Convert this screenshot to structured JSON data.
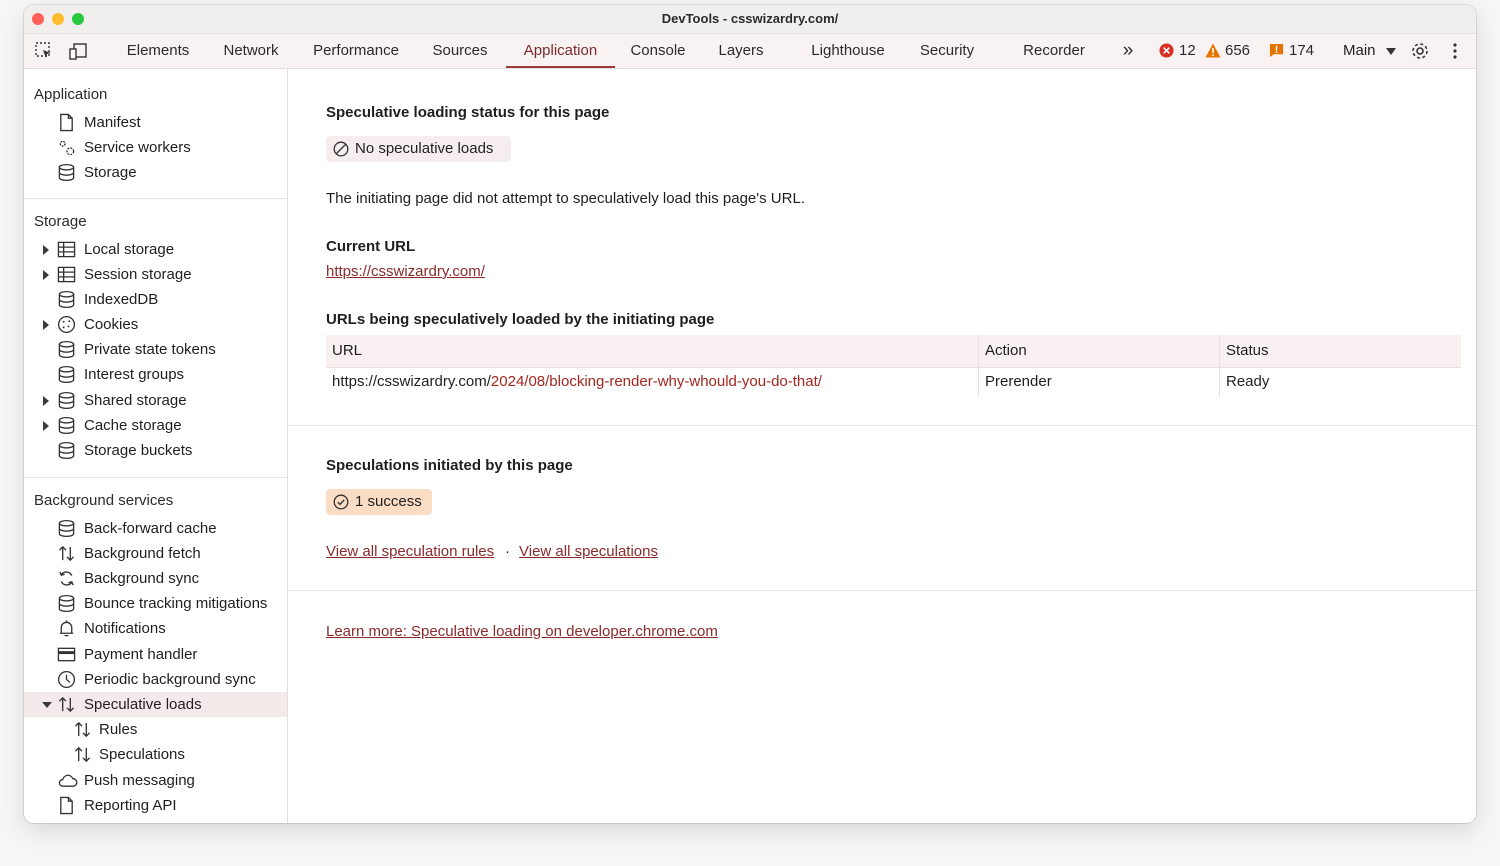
{
  "window": {
    "title": "DevTools - csswizardry.com/"
  },
  "toolbar": {
    "tabs": [
      {
        "label": "Elements"
      },
      {
        "label": "Network"
      },
      {
        "label": "Performance"
      },
      {
        "label": "Sources"
      },
      {
        "label": "Application"
      },
      {
        "label": "Console"
      },
      {
        "label": "Layers"
      },
      {
        "label": "Lighthouse"
      },
      {
        "label": "Security"
      },
      {
        "label": "Recorder"
      }
    ],
    "active_tab": "Application",
    "more_tabs": "»",
    "errors": "12",
    "warnings": "656",
    "issues": "174",
    "context": "Main"
  },
  "sidebar": {
    "application": {
      "title": "Application",
      "items": [
        {
          "label": "Manifest",
          "icon": "document-icon"
        },
        {
          "label": "Service workers",
          "icon": "gears-icon"
        },
        {
          "label": "Storage",
          "icon": "database-icon"
        }
      ]
    },
    "storage": {
      "title": "Storage",
      "items": [
        {
          "label": "Local storage",
          "icon": "table-icon"
        },
        {
          "label": "Session storage",
          "icon": "table-icon"
        },
        {
          "label": "IndexedDB",
          "icon": "database-icon"
        },
        {
          "label": "Cookies",
          "icon": "cookie-icon"
        },
        {
          "label": "Private state tokens",
          "icon": "database-icon"
        },
        {
          "label": "Interest groups",
          "icon": "database-icon"
        },
        {
          "label": "Shared storage",
          "icon": "database-icon"
        },
        {
          "label": "Cache storage",
          "icon": "database-icon"
        },
        {
          "label": "Storage buckets",
          "icon": "database-icon"
        }
      ]
    },
    "background": {
      "title": "Background services",
      "items": [
        {
          "label": "Back-forward cache",
          "icon": "database-icon"
        },
        {
          "label": "Background fetch",
          "icon": "up-down-arrows-icon"
        },
        {
          "label": "Background sync",
          "icon": "sync-icon"
        },
        {
          "label": "Bounce tracking mitigations",
          "icon": "database-icon"
        },
        {
          "label": "Notifications",
          "icon": "bell-icon"
        },
        {
          "label": "Payment handler",
          "icon": "card-icon"
        },
        {
          "label": "Periodic background sync",
          "icon": "clock-icon"
        },
        {
          "label": "Speculative loads",
          "icon": "up-down-arrows-icon"
        },
        {
          "label": "Rules",
          "icon": "up-down-arrows-icon"
        },
        {
          "label": "Speculations",
          "icon": "up-down-arrows-icon"
        },
        {
          "label": "Push messaging",
          "icon": "cloud-icon"
        },
        {
          "label": "Reporting API",
          "icon": "document-icon"
        }
      ]
    }
  },
  "content": {
    "status_heading": "Speculative loading status for this page",
    "status_badge": "No speculative loads",
    "status_text": "The initiating page did not attempt to speculatively load this page's URL.",
    "current_url_heading": "Current URL",
    "current_url": "https://csswizardry.com/",
    "urls_heading": "URLs being speculatively loaded by the initiating page",
    "table": {
      "headers": [
        "URL",
        "Action",
        "Status"
      ],
      "rows": [
        {
          "url_base": "https://csswizardry.com/",
          "url_path": "2024/08/blocking-render-why-whould-you-do-that/",
          "action": "Prerender",
          "status": "Ready"
        }
      ]
    },
    "initiated_heading": "Speculations initiated by this page",
    "initiated_badge": "1 success",
    "link_rules": "View all speculation rules",
    "link_separator": "·",
    "link_speculations": "View all speculations",
    "learn_more": "Learn more: Speculative loading on developer.chrome.com"
  },
  "colors": {
    "accent": "#9a3b3b",
    "link": "#8a2b2b",
    "error": "#d93025",
    "warning": "#e37400",
    "issue": "#e37400"
  }
}
